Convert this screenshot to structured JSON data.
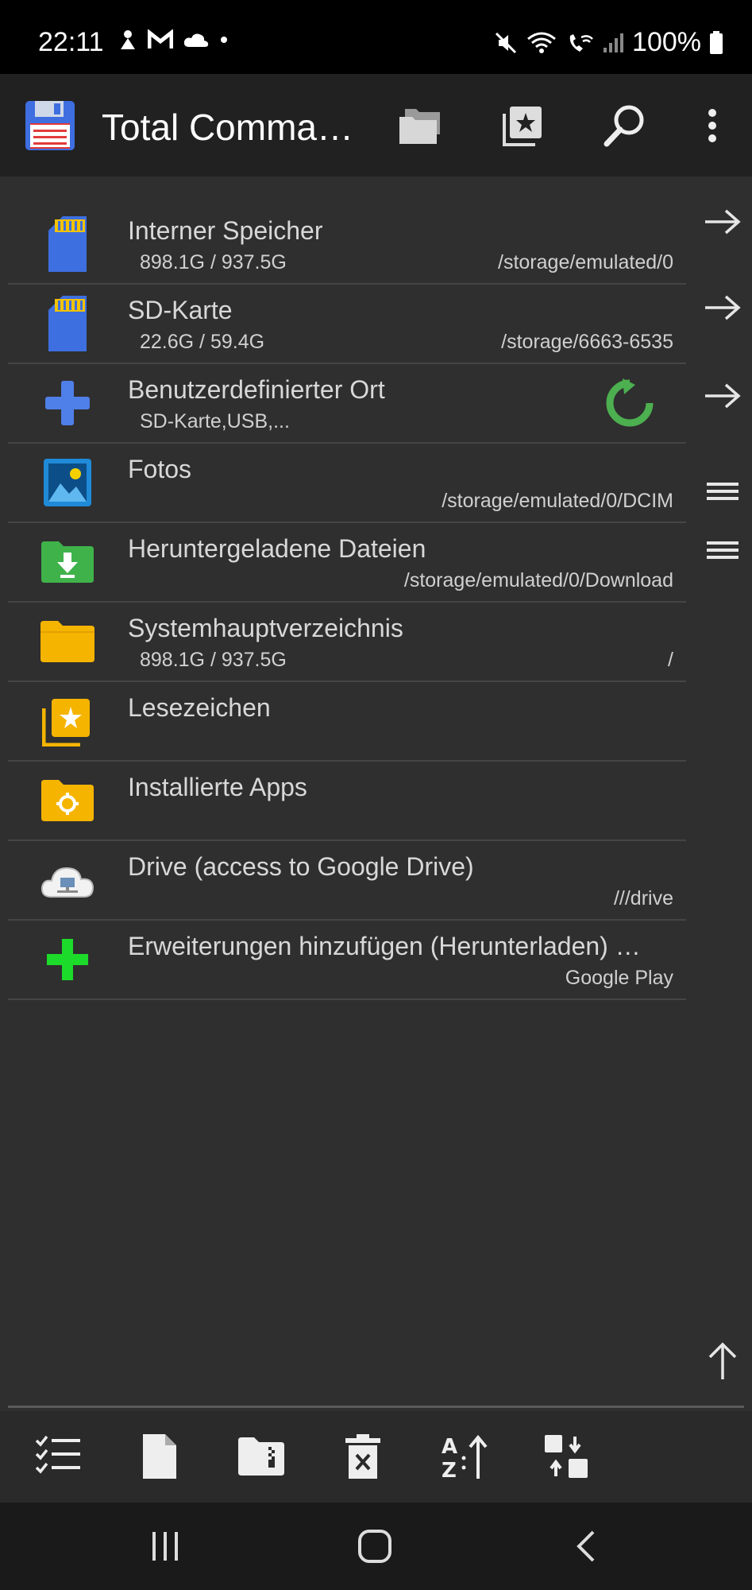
{
  "status_bar": {
    "time": "22:11",
    "battery": "100%"
  },
  "app_bar": {
    "title": "Total Comma…",
    "icons": [
      "floppy-disk-icon",
      "folders-icon",
      "bookmarks-icon",
      "search-icon",
      "more-vert-icon"
    ]
  },
  "entries": [
    {
      "name": "Interner Speicher",
      "sub": "898.1G / 937.5G",
      "path": "/storage/emulated/0",
      "icon": "sd-card-icon"
    },
    {
      "name": "SD-Karte",
      "sub": "22.6G / 59.4G",
      "path": "/storage/6663-6535",
      "icon": "sd-card-icon"
    },
    {
      "name": "Benutzerdefinierter Ort",
      "sub": "SD-Karte,USB,...",
      "path": "",
      "icon": "plus-icon"
    },
    {
      "name": "Fotos",
      "sub": "",
      "path": "/storage/emulated/0/DCIM",
      "icon": "photo-icon"
    },
    {
      "name": "Heruntergeladene Dateien",
      "sub": "",
      "path": "/storage/emulated/0/Download",
      "icon": "download-folder-icon"
    },
    {
      "name": "Systemhauptverzeichnis",
      "sub": "898.1G / 937.5G",
      "path": "/",
      "icon": "folder-icon"
    },
    {
      "name": "Lesezeichen",
      "sub": "",
      "path": "",
      "icon": "bookmarks-folder-icon"
    },
    {
      "name": "Installierte Apps",
      "sub": "",
      "path": "",
      "icon": "apps-folder-icon"
    },
    {
      "name": "Drive (access to Google Drive)",
      "sub": "",
      "path": "///drive",
      "icon": "cloud-icon"
    },
    {
      "name": "Erweiterungen hinzufügen (Herunterladen) …",
      "sub": "",
      "path": "Google Play",
      "icon": "green-plus-icon"
    }
  ],
  "colors": {
    "background": "#2f2f2f",
    "appbar": "#212121",
    "accent_green": "#4caf50",
    "folder_yellow": "#f5b400",
    "sd_blue": "#3d6fe0"
  }
}
